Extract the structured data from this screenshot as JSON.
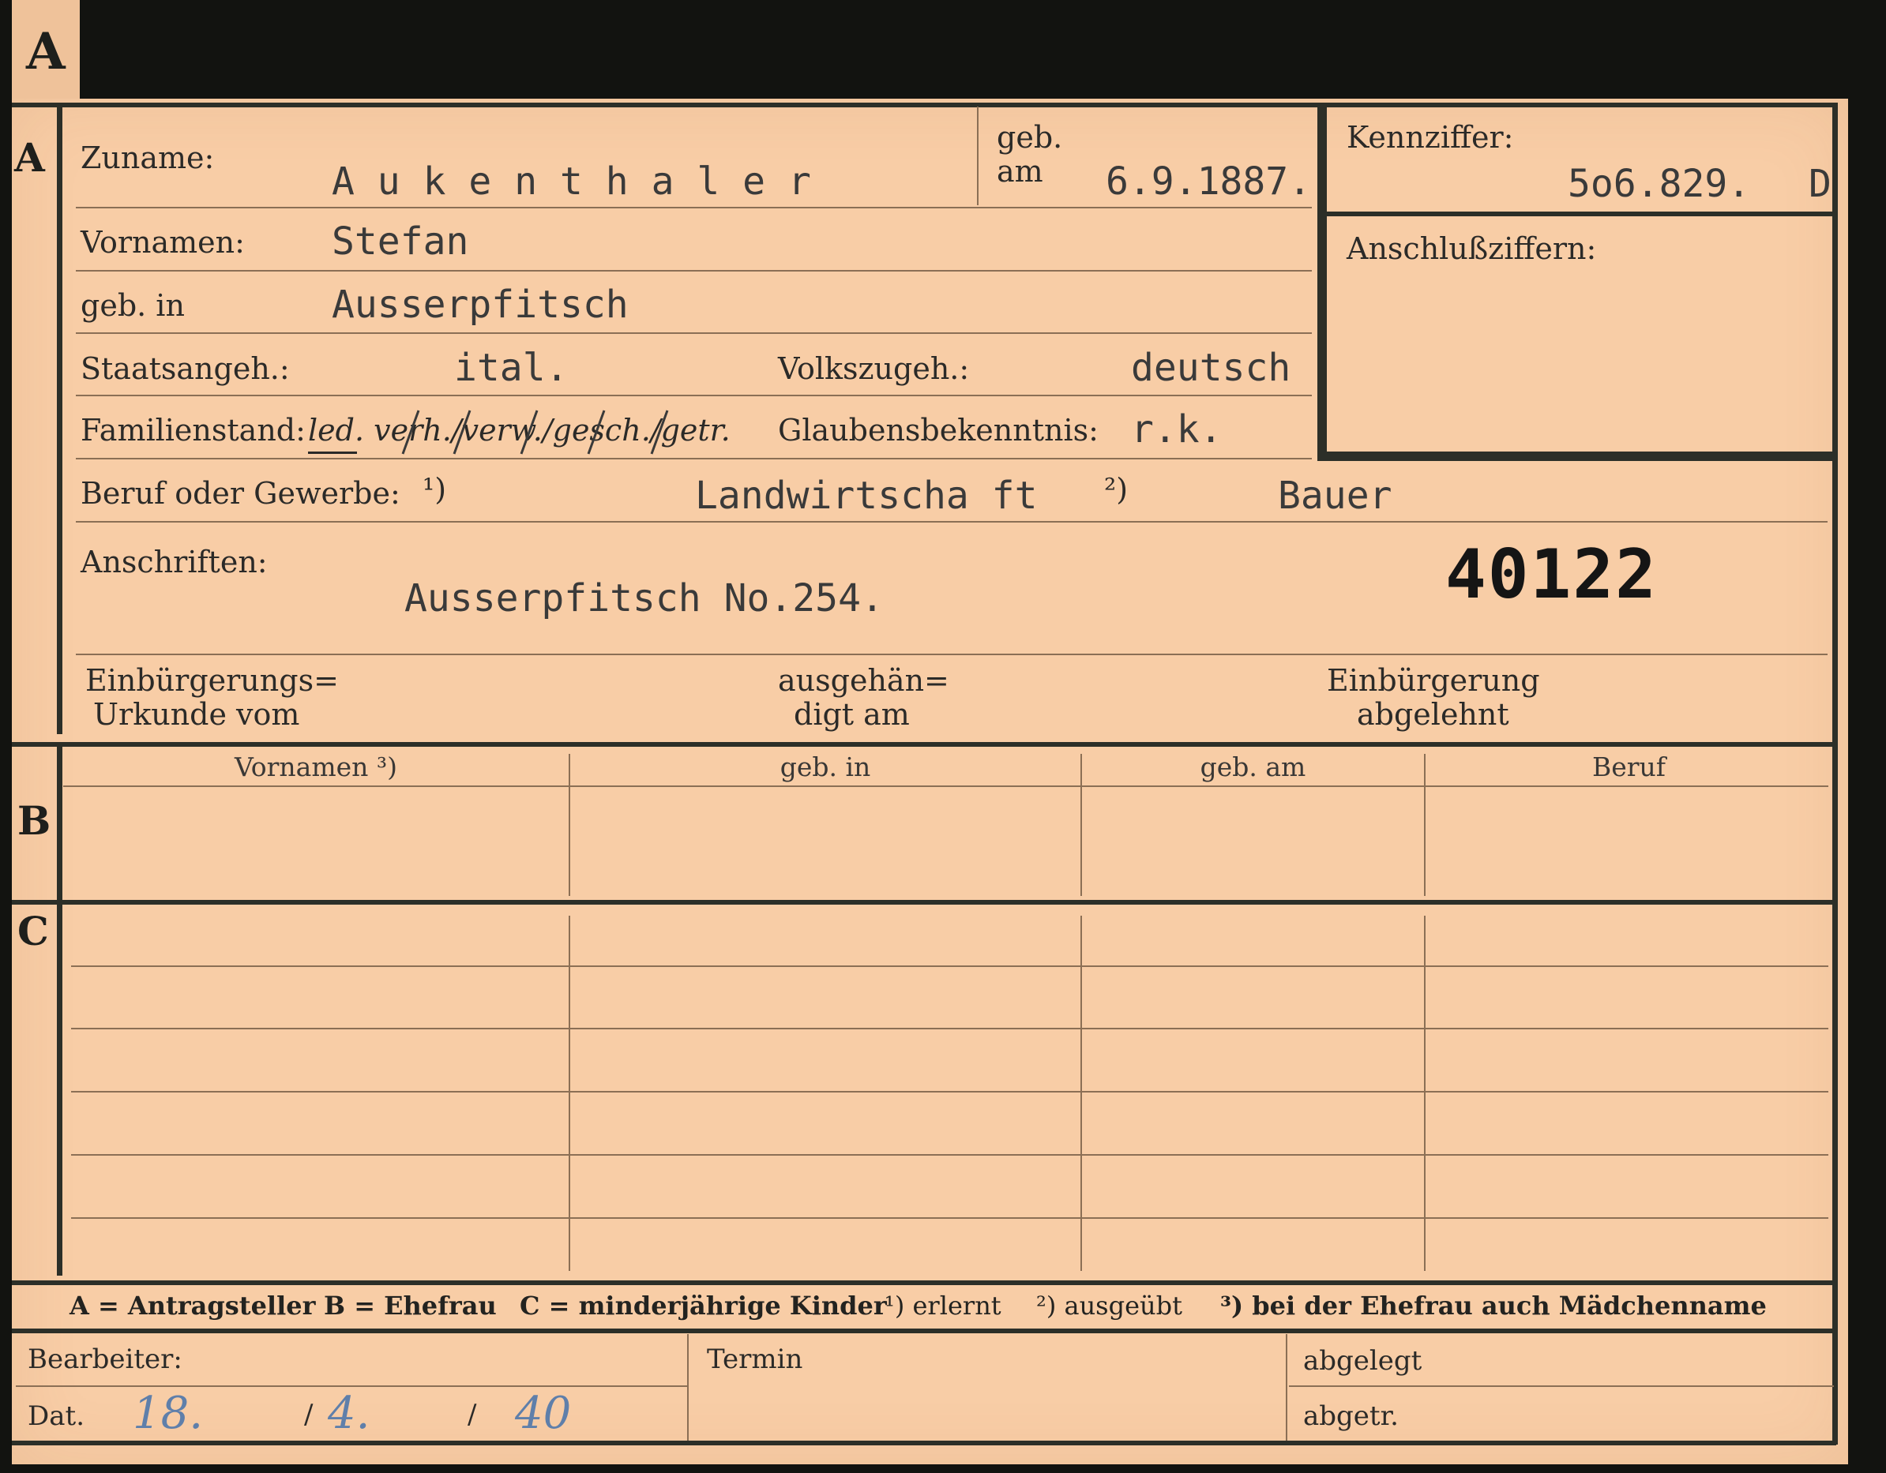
{
  "tab_letter": "A",
  "sections": {
    "a": "A",
    "b": "B",
    "c": "C"
  },
  "labels": {
    "zuname": "Zuname:",
    "geb_am_1": "geb.",
    "geb_am_2": "am",
    "kennziffer": "Kennziffer:",
    "anschlussziffern": "Anschlußziffern:",
    "vornamen": "Vornamen:",
    "geb_in": "geb. in",
    "staatsangeh": "Staatsangeh.:",
    "volkszugeh": "Volkszugeh.:",
    "familienstand": "Familienstand:",
    "familienstand_options": "led. verh./verw./gesch./getr.",
    "glaubensbekenntnis": "Glaubensbekenntnis:",
    "beruf": "Beruf oder Gewerbe:",
    "anschriften": "Anschriften:",
    "einbuergerungs_1": "Einbürgerungs=",
    "einbuergerungs_2": "Urkunde vom",
    "ausgehaendigt_1": "ausgehän=",
    "ausgehaendigt_2": "digt am",
    "einbuergerung_1": "Einbürgerung",
    "einbuergerung_2": "abgelehnt"
  },
  "values": {
    "zuname": "A u k e n t h a l e r",
    "geb_am": "6.9.1887.",
    "kennziffer": "5o6.829.",
    "kennziffer_suffix": "D",
    "vornamen": "Stefan",
    "geb_in": "Ausserpfitsch",
    "staatsangeh": "ital.",
    "volkszugeh": "deutsch",
    "glaubensbekenntnis": "r.k.",
    "beruf_erlernt": "Landwirtscha ft",
    "beruf_ausgeuebt": "Bauer",
    "anschrift": "Ausserpfitsch No.254.",
    "stamp_number": "40122"
  },
  "footnote_marks": {
    "one": "¹)",
    "two": "²)",
    "three": "³)"
  },
  "table_headers": [
    "Vornamen ³)",
    "geb. in",
    "geb. am",
    "Beruf"
  ],
  "legend": {
    "a": "A = Antragsteller",
    "b": "B = Ehefrau",
    "c": "C = minderjährige Kinder",
    "n1": "¹) erlernt",
    "n2": "²) ausgeübt",
    "n3": "³) bei der Ehefrau auch Mädchenname"
  },
  "footer": {
    "bearbeiter": "Bearbeiter:",
    "dat": "Dat.",
    "day": "18.",
    "month": "4.",
    "year": "40",
    "sep": "/",
    "termin": "Termin",
    "abgelegt": "abgelegt",
    "abgetr": "abgetr."
  }
}
